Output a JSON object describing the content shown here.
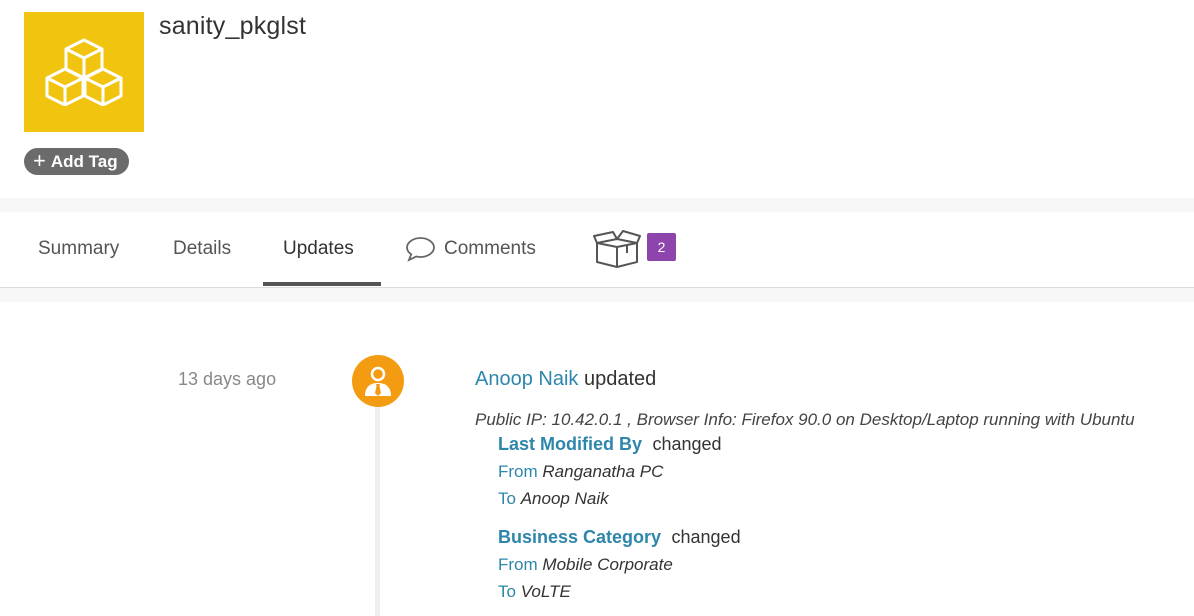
{
  "package": {
    "name": "sanity_pkglst",
    "logo_icon": "boxes-icon",
    "logo_color": "#f1c40f",
    "add_tag_label": "Add Tag"
  },
  "tabs": [
    {
      "label": "Summary",
      "active": false
    },
    {
      "label": "Details",
      "active": false
    },
    {
      "label": "Updates",
      "active": true
    },
    {
      "label": "Comments",
      "icon": "comment-icon",
      "active": false
    },
    {
      "label": "",
      "icon": "gift-box-icon",
      "badge": "2",
      "active": false
    }
  ],
  "colors": {
    "link": "#2e86ab",
    "badge": "#8e44ad",
    "avatar": "#f39c12"
  },
  "update": {
    "time_ago": "13 days ago",
    "user": "Anoop Naik",
    "action": "updated",
    "meta": "Public IP: 10.42.0.1 , Browser Info: Firefox 90.0 on Desktop/Laptop running with Ubuntu",
    "changes": [
      {
        "field": "Last Modified By",
        "verb": "changed",
        "from_label": "From",
        "from": "Ranganatha PC",
        "to_label": "To",
        "to": "Anoop Naik"
      },
      {
        "field": "Business Category",
        "verb": "changed",
        "from_label": "From",
        "from": "Mobile Corporate",
        "to_label": "To",
        "to": "VoLTE"
      }
    ]
  }
}
